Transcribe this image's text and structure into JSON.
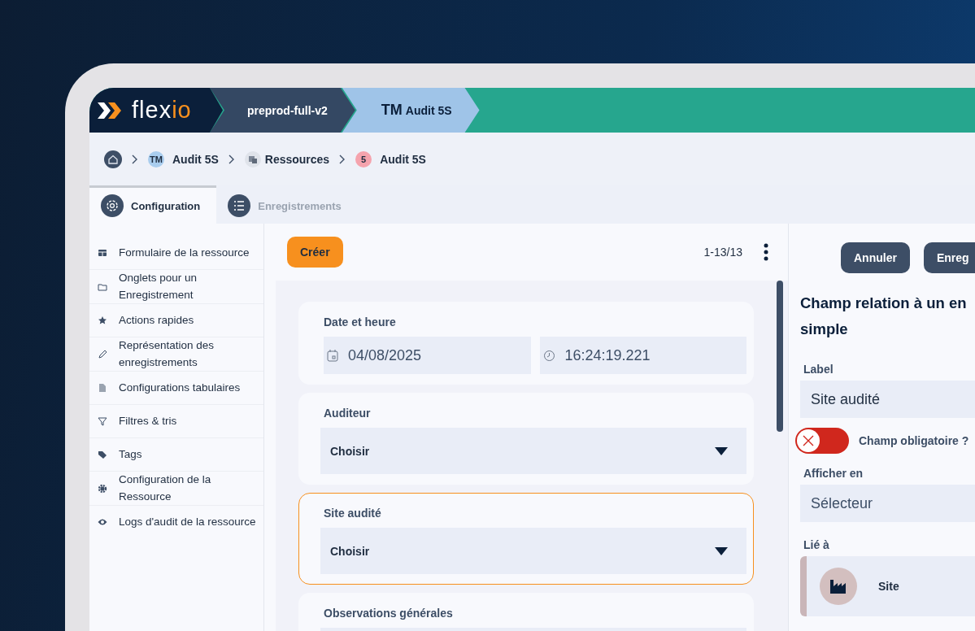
{
  "topbar": {
    "logo": [
      "fle",
      "x",
      "io"
    ],
    "segments": [
      {
        "kind": "env",
        "label": "preprod-full-v2"
      },
      {
        "kind": "app",
        "badge": "TM",
        "label": "Audit 5S"
      }
    ]
  },
  "breadcrumb": [
    {
      "kind": "home"
    },
    {
      "kind": "badge",
      "badge": "TM",
      "label": "Audit 5S",
      "color": "#a9cdee"
    },
    {
      "kind": "resources",
      "label": "Ressources"
    },
    {
      "kind": "badge",
      "badge": "5",
      "label": "Audit 5S",
      "color": "#f5a3ad"
    }
  ],
  "tabs": [
    {
      "kind": "gear",
      "label": "Configuration",
      "selected": true
    },
    {
      "kind": "list",
      "label": "Enregistrements",
      "selected": false
    }
  ],
  "sidebar": {
    "items": [
      {
        "kind": "table",
        "label": "Formulaire de la ressource"
      },
      {
        "kind": "folder",
        "label": "Onglets pour un Enregistrement"
      },
      {
        "kind": "star",
        "label": "Actions rapides"
      },
      {
        "kind": "pencil",
        "label": "Représentation des enregistrements"
      },
      {
        "kind": "doc",
        "label": "Configurations tabulaires"
      },
      {
        "kind": "filter",
        "label": "Filtres & tris"
      },
      {
        "kind": "tag",
        "label": "Tags"
      },
      {
        "kind": "gear",
        "label": "Configuration de la Ressource"
      },
      {
        "kind": "eye",
        "label": "Logs d'audit de la ressource"
      }
    ]
  },
  "list": {
    "create_button": "Créer",
    "pager": "1-13/13",
    "cards": [
      {
        "kind": "datetime",
        "label": "Date et heure",
        "date": "04/08/2025",
        "time": "16:24:19.221",
        "selected": false
      },
      {
        "kind": "select",
        "label": "Auditeur",
        "value": "Choisir",
        "selected": false
      },
      {
        "kind": "select",
        "label": "Site audité",
        "value": "Choisir",
        "selected": true
      },
      {
        "kind": "text",
        "label": "Observations générales",
        "selected": false
      }
    ]
  },
  "panel": {
    "buttons": [
      "Annuler",
      "Enreg"
    ],
    "title_lines": [
      "Champ relation à un en",
      "simple"
    ],
    "fields": [
      {
        "kind": "input",
        "label": "Label",
        "value": "Site audité"
      },
      {
        "kind": "toggle",
        "label": "Champ obligatoire ?",
        "checked": false
      },
      {
        "kind": "input",
        "label": "Afficher en",
        "value": "Sélecteur"
      },
      {
        "kind": "link",
        "label": "Lié à",
        "value": "Site"
      }
    ]
  }
}
